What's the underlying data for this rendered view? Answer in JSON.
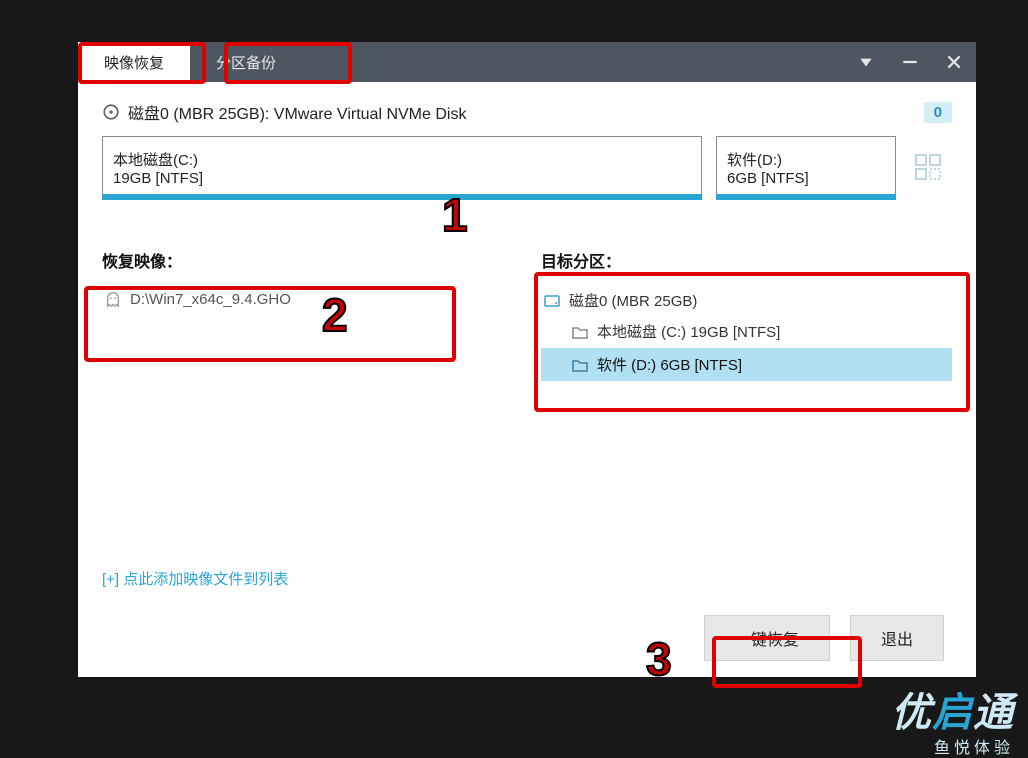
{
  "tabs": {
    "restore": "映像恢复",
    "backup": "分区备份"
  },
  "disk": {
    "label": "磁盘0 (MBR 25GB): VMware Virtual NVMe Disk",
    "badge": "0"
  },
  "partitions": {
    "c": {
      "name": "本地磁盘(C:)",
      "size": "19GB [NTFS]"
    },
    "d": {
      "name": "软件(D:)",
      "size": "6GB [NTFS]"
    }
  },
  "left": {
    "title": "恢复映像：",
    "gho": "D:\\Win7_x64c_9.4.GHO",
    "add_link": "[+] 点此添加映像文件到列表"
  },
  "right": {
    "title": "目标分区：",
    "root": "磁盘0 (MBR 25GB)",
    "child_c": "本地磁盘 (C:) 19GB [NTFS]",
    "child_d": "软件 (D:) 6GB [NTFS]"
  },
  "buttons": {
    "restore": "一键恢复",
    "exit": "退出"
  },
  "annotations": {
    "n1": "1",
    "n2": "2",
    "n3": "3"
  },
  "brand": {
    "main1": "优",
    "main2": "启",
    "main3": "通",
    "sub": "鱼悦体验"
  }
}
